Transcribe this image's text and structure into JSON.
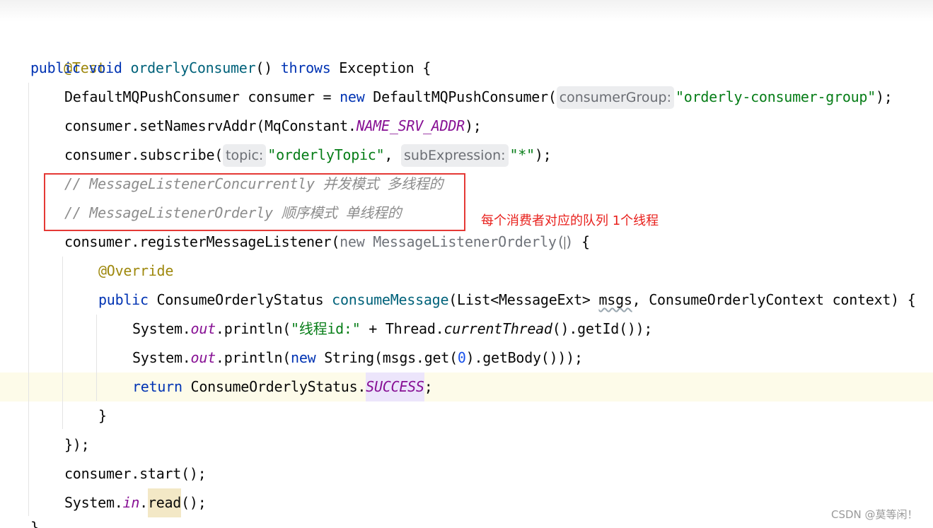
{
  "editor": {
    "lines": {
      "l1": {
        "annotation": "@Test"
      },
      "l2": {
        "kw_public": "public",
        "kw_void": "void",
        "method": "orderlyConsumer",
        "paren": "() ",
        "kw_throws": "throws",
        "rest": " Exception {"
      },
      "l3": {
        "code_a": "DefaultMQPushConsumer consumer = ",
        "kw_new": "new",
        "code_b": " DefaultMQPushConsumer(",
        "hint": "consumerGroup:",
        "str": "\"orderly-consumer-group\"",
        "tail": ");"
      },
      "l4": {
        "code_a": "consumer.setNamesrvAddr(MqConstant.",
        "static": "NAME_SRV_ADDR",
        "tail": ");"
      },
      "l5": {
        "code_a": "consumer.subscribe(",
        "hint1": "topic:",
        "str1": "\"orderlyTopic\"",
        "sep": ", ",
        "hint2": "subExpression:",
        "str2": "\"*\"",
        "tail": ");"
      },
      "l6": {
        "comment": "// MessageListenerConcurrently 并发模式 多线程的"
      },
      "l7": {
        "comment": "// MessageListenerOrderly 顺序模式 单线程的"
      },
      "l8": {
        "code_a": "consumer.registerMessageListener(",
        "dim": "new MessageListenerOrderly(",
        "dim_tail": ")",
        "tail": " {"
      },
      "l9": {
        "annotation": "@Override"
      },
      "l10": {
        "kw_public": "public",
        "code_a": " ConsumeOrderlyStatus ",
        "method": "consumeMessage",
        "code_b": "(List<MessageExt> ",
        "msgs": "msgs",
        "code_c": ", ConsumeOrderlyContext context) {"
      },
      "l11": {
        "code_a": "System.",
        "static": "out",
        "code_b": ".println(",
        "str": "\"线程id:\"",
        "code_c": " + Thread.",
        "staticfn": "currentThread",
        "code_d": "().getId());"
      },
      "l12": {
        "code_a": "System.",
        "static": "out",
        "code_b": ".println(",
        "kw_new": "new",
        "code_c": " String(msgs.get(",
        "num": "0",
        "code_d": ").getBody()));"
      },
      "l13": {
        "kw_return": "return",
        "code_a": " ConsumeOrderlyStatus.",
        "static": "SUCCESS",
        "tail": ";"
      },
      "l14": {
        "code": "}"
      },
      "l15": {
        "code": "});"
      },
      "l16": {
        "code": "consumer.start();"
      },
      "l17": {
        "code_a": "System.",
        "static": "in",
        "dot": ".",
        "read": "read",
        "tail": "();"
      },
      "l18": {
        "code": "}"
      }
    }
  },
  "annotation_note": "每个消费者对应的队列 1个线程",
  "watermark": "CSDN @莫等闲！",
  "colors": {
    "keyword": "#0033b3",
    "annotation": "#9e880d",
    "string": "#067d17",
    "static_field": "#871094",
    "comment": "#8c8c8c",
    "red_box": "#e53935",
    "current_line": "#fdfbe9"
  }
}
